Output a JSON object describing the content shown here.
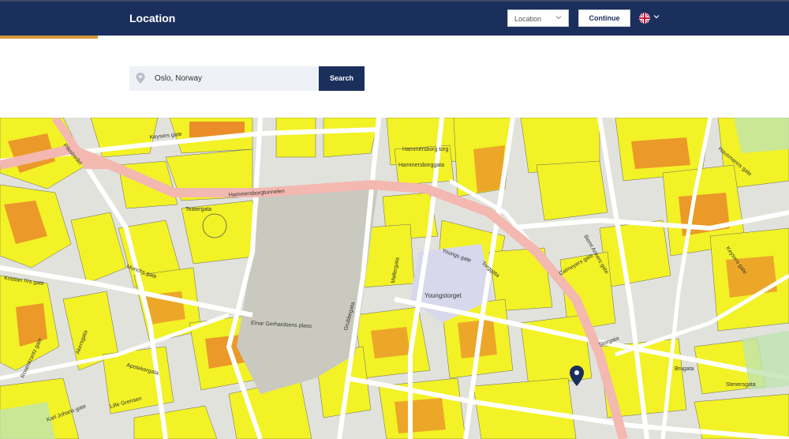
{
  "header": {
    "title": "Location",
    "select_value": "Location",
    "continue_label": "Continue",
    "language_icon": "uk-flag-icon"
  },
  "search": {
    "value": "Oslo, Norway",
    "button_label": "Search",
    "icon": "location-pin-icon"
  },
  "colors": {
    "header_bg": "#1b2f5c",
    "accent": "#d79a3a",
    "building_yellow": "#f2f226",
    "building_orange": "#e8742a",
    "road_pink": "#f3b8b0",
    "plaza": "#c9c9c0"
  },
  "map": {
    "streets": [
      "Keysers gate",
      "Hammersborg torg",
      "Hammersborggata",
      "Hammersborgtunnelen",
      "Teatergata",
      "Pilestredet",
      "Munchs gate",
      "Kristian IVs gate",
      "Youngs gate",
      "Torggata",
      "Møllergata",
      "Calmeyers gate",
      "Bernt Ankers gate",
      "Hausmanns gate",
      "Storgata",
      "Brugata",
      "Stenersgata",
      "Youngstorget",
      "Karl Johans gate",
      "Lille Grensen",
      "Akersgata",
      "Rosenkrantz gate",
      "Keysers gate",
      "Einar Gerhardsens plass",
      "Grubbegata",
      "Apotekergata"
    ]
  }
}
